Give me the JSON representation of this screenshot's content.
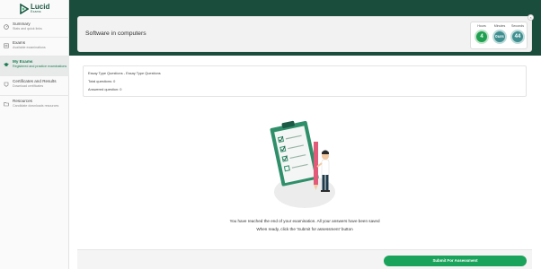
{
  "brand": {
    "name": "Lucid",
    "sub": "Exams",
    "logo_icon": "triangle-play-logo"
  },
  "sidebar": {
    "items": [
      {
        "title": "Summary",
        "desc": "Stats and quick links",
        "icon": "dashboard-icon",
        "active": false
      },
      {
        "title": "Exams",
        "desc": "Available examinations",
        "icon": "exam-list-icon",
        "active": false
      },
      {
        "title": "My Exams",
        "desc": "Registered and practice examinations",
        "icon": "graduation-cap-icon",
        "active": true
      },
      {
        "title": "Certificates and Results",
        "desc": "Download certificates",
        "icon": "certificate-icon",
        "active": false
      },
      {
        "title": "Resources",
        "desc": "Candidate downloads resources",
        "icon": "folder-icon",
        "active": false
      }
    ]
  },
  "exam": {
    "title": "Software in computers",
    "close_label": "×"
  },
  "timer": {
    "hours_label": "Hours",
    "hours_value": "4",
    "minutes_label": "Minutes",
    "minutes_value": "0urs",
    "seconds_label": "Seconds",
    "seconds_value": "44"
  },
  "info": {
    "section": "Essay Type Questions - Essay Type Questions",
    "total": "Total questions: 0",
    "answered": "Answered question: 0"
  },
  "message": {
    "line1": "You have reached the end of your examination. All your answers have been saved",
    "line2": "When ready, click the 'Submit for assessment' button"
  },
  "actions": {
    "submit_label": "Submit For Assessment"
  },
  "colors": {
    "brand_green": "#1b4d3c",
    "accent_green": "#1aa35a",
    "timer_teal": "#3f8f91"
  }
}
